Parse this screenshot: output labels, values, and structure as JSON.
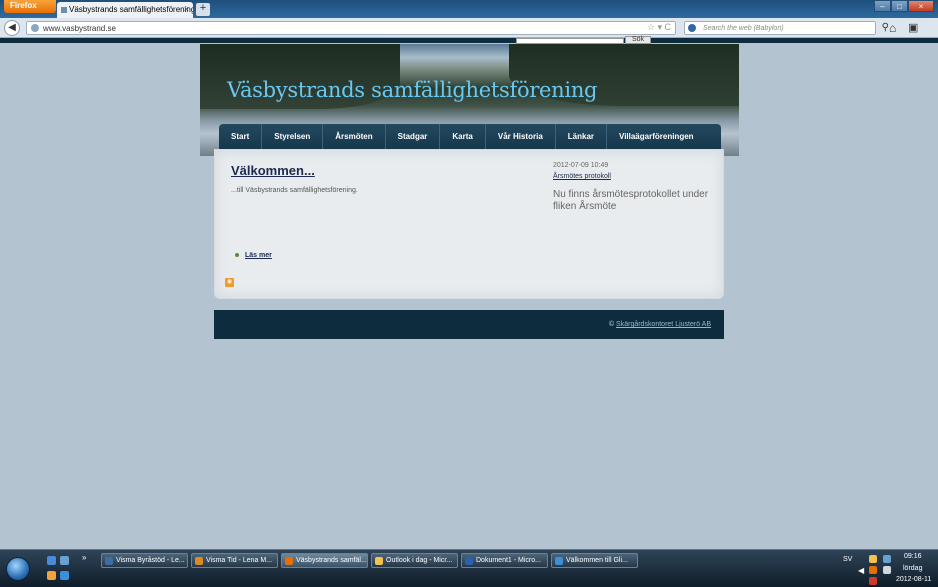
{
  "browser": {
    "app_button": "Firefox",
    "tab_title": "Väsbystrands samfällighetsförening",
    "new_tab": "+",
    "url": "www.vasbystrand.se",
    "search_placeholder": "Search the web (Babylon)"
  },
  "site": {
    "search_button": "Sök",
    "title": "Väsbystrands samfällighetsförening",
    "nav": [
      "Start",
      "Styrelsen",
      "Årsmöten",
      "Stadgar",
      "Karta",
      "Vår Historia",
      "Länkar",
      "Villaägarföreningen"
    ],
    "welcome_title": "Välkommen...",
    "welcome_sub": "...till Väsbystrands samfällighetsförening.",
    "read_more": "Läs mer",
    "news": {
      "date": "2012-07-09 10:49",
      "link": "Årsmötes protokoll",
      "text": "Nu finns årsmötesprotokollet under fliken Årsmöte"
    },
    "footer": {
      "copyright": "©",
      "link": "Skärgårdskontoret Ljusterö AB"
    }
  },
  "taskbar": {
    "tasks": [
      {
        "label": "Visma Byråstöd - Le...",
        "color": "#3b6ea8"
      },
      {
        "label": "Visma Tid - Lena M...",
        "color": "#d98b2b"
      },
      {
        "label": "Väsbystrands samfäl...",
        "color": "#e56f06"
      },
      {
        "label": "Outlook i dag - Micr...",
        "color": "#f2c14e"
      },
      {
        "label": "Dokument1 - Micro...",
        "color": "#2b5fb0"
      },
      {
        "label": "Välkommen till Gli...",
        "color": "#3a8fd8"
      }
    ],
    "lang": "SV",
    "time": "09:16",
    "day": "lördag",
    "date": "2012-08-11"
  }
}
